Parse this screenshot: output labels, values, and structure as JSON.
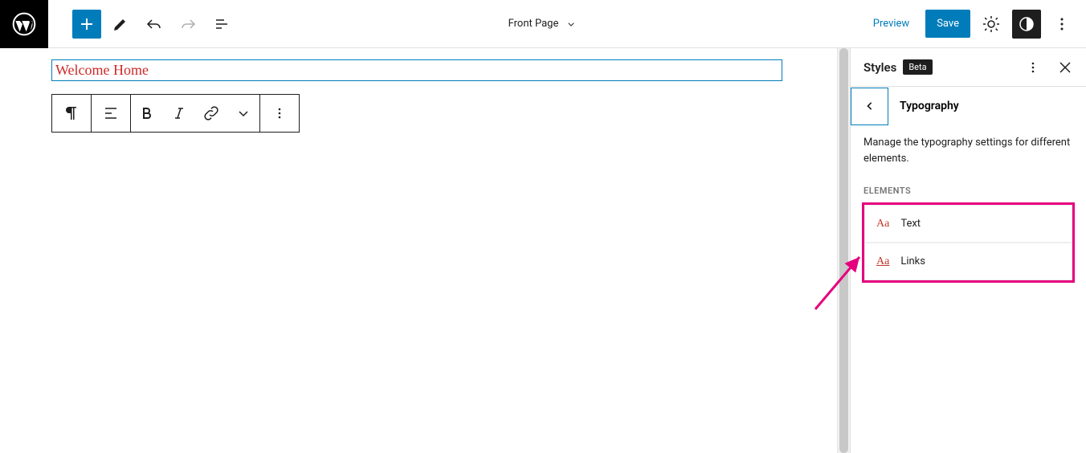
{
  "topbar": {
    "document_title": "Front Page",
    "preview_label": "Preview",
    "save_label": "Save"
  },
  "editor": {
    "paragraph_text": "Welcome Home"
  },
  "sidebar": {
    "panel_title": "Styles",
    "badge_label": "Beta",
    "section_title": "Typography",
    "description": "Manage the typography settings for different elements.",
    "elements_label": "ELEMENTS",
    "items": [
      {
        "icon": "Aa",
        "label": "Text",
        "underline": false
      },
      {
        "icon": "Aa",
        "label": "Links",
        "underline": true
      }
    ]
  }
}
